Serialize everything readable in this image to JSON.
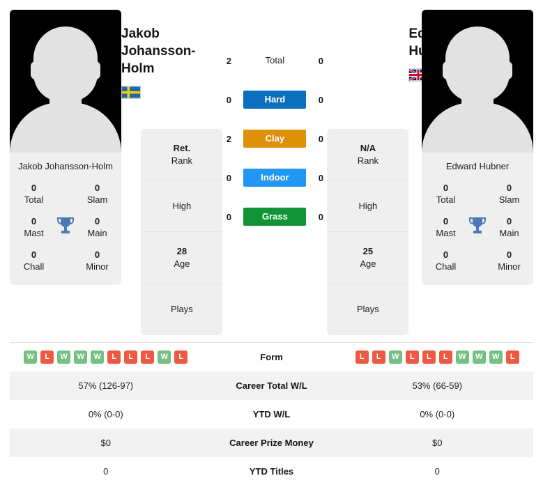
{
  "players": {
    "left": {
      "name": "Jakob Johansson-Holm",
      "card_name": "Jakob Johansson-Holm",
      "flag": "sweden-flag",
      "avatar": "player-avatar-placeholder",
      "titles": {
        "total_value": "0",
        "total_label": "Total",
        "slam_value": "0",
        "slam_label": "Slam",
        "mast_value": "0",
        "mast_label": "Mast",
        "main_value": "0",
        "main_label": "Main",
        "chall_value": "0",
        "chall_label": "Chall",
        "minor_value": "0",
        "minor_label": "Minor"
      },
      "info": {
        "rank_value": "Ret.",
        "rank_label": "Rank",
        "high_value": "",
        "high_label": "High",
        "age_value": "28",
        "age_label": "Age",
        "plays_value": "",
        "plays_label": "Plays"
      },
      "form": [
        "W",
        "L",
        "W",
        "W",
        "W",
        "L",
        "L",
        "L",
        "W",
        "L"
      ],
      "career_total_wl": "57% (126-97)",
      "ytd_wl": "0% (0-0)",
      "career_prize_money": "$0",
      "ytd_titles": "0"
    },
    "right": {
      "name": "Edward Hubner",
      "card_name": "Edward Hubner",
      "flag": "united-kingdom-flag",
      "avatar": "player-avatar-placeholder",
      "titles": {
        "total_value": "0",
        "total_label": "Total",
        "slam_value": "0",
        "slam_label": "Slam",
        "mast_value": "0",
        "mast_label": "Mast",
        "main_value": "0",
        "main_label": "Main",
        "chall_value": "0",
        "chall_label": "Chall",
        "minor_value": "0",
        "minor_label": "Minor"
      },
      "info": {
        "rank_value": "N/A",
        "rank_label": "Rank",
        "high_value": "",
        "high_label": "High",
        "age_value": "25",
        "age_label": "Age",
        "plays_value": "",
        "plays_label": "Plays"
      },
      "form": [
        "L",
        "L",
        "W",
        "L",
        "L",
        "L",
        "W",
        "W",
        "W",
        "L"
      ],
      "career_total_wl": "53% (66-59)",
      "ytd_wl": "0% (0-0)",
      "career_prize_money": "$0",
      "ytd_titles": "0"
    }
  },
  "surfaces": [
    {
      "label": "Total",
      "left": "2",
      "right": "0",
      "color": "transparent",
      "text_color": "#1c1c1c"
    },
    {
      "label": "Hard",
      "left": "0",
      "right": "0",
      "color": "#0b6fbd",
      "text_color": "#ffffff"
    },
    {
      "label": "Clay",
      "left": "2",
      "right": "0",
      "color": "#dd9108",
      "text_color": "#ffffff"
    },
    {
      "label": "Indoor",
      "left": "0",
      "right": "0",
      "color": "#2196f3",
      "text_color": "#ffffff"
    },
    {
      "label": "Grass",
      "left": "0",
      "right": "0",
      "color": "#119438",
      "text_color": "#ffffff"
    }
  ],
  "compare_rows": [
    {
      "label": "Form",
      "left": "",
      "right": "",
      "type": "form"
    },
    {
      "label": "Career Total W/L",
      "left": "57% (126-97)",
      "right": "53% (66-59)",
      "type": "text"
    },
    {
      "label": "YTD W/L",
      "left": "0% (0-0)",
      "right": "0% (0-0)",
      "type": "text"
    },
    {
      "label": "Career Prize Money",
      "left": "$0",
      "right": "$0",
      "type": "text"
    },
    {
      "label": "YTD Titles",
      "left": "0",
      "right": "0",
      "type": "text"
    }
  ],
  "colors": {
    "win_badge": "#76c084",
    "loss_badge": "#ef5842",
    "trophy": "#4a7ab5",
    "card_bg": "#efefef",
    "row_alt_bg": "#f2f2f2"
  }
}
